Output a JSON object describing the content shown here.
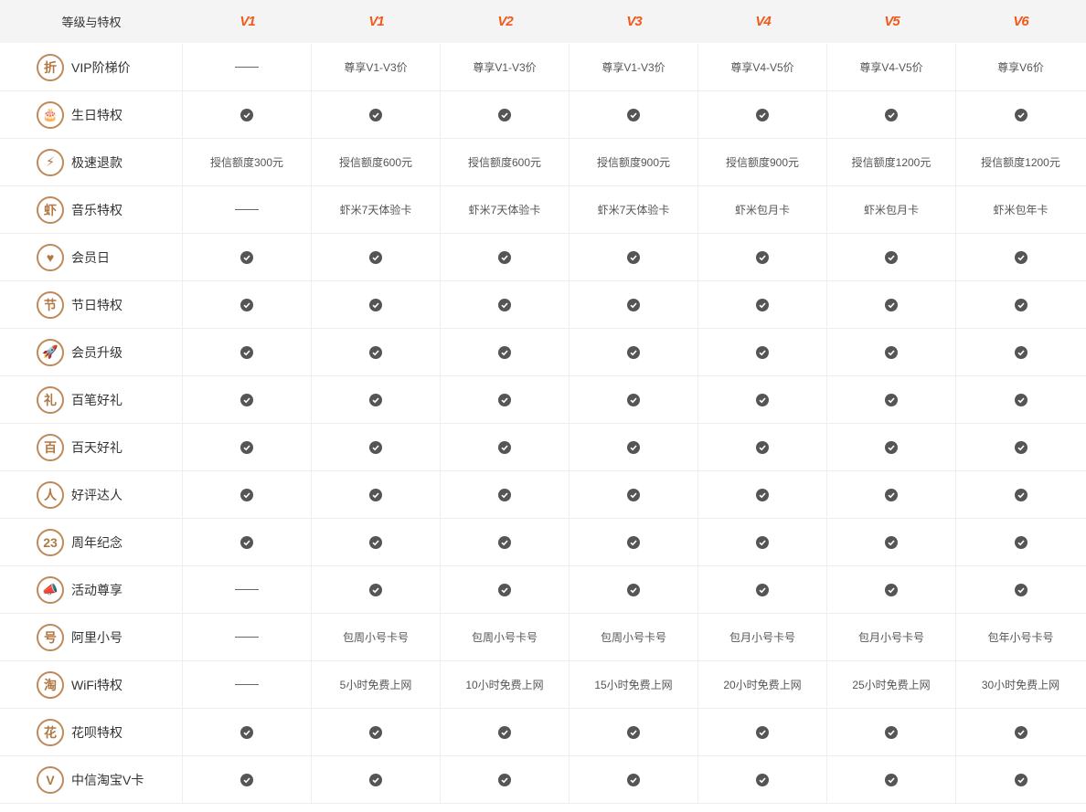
{
  "header": {
    "first_col": "等级与特权",
    "levels": [
      "V1",
      "V1",
      "V2",
      "V3",
      "V4",
      "V5",
      "V6"
    ]
  },
  "rows": [
    {
      "name": "VIP阶梯价",
      "icon": "discount-icon",
      "glyph": "折",
      "cells": [
        "-",
        "尊享V1-V3价",
        "尊享V1-V3价",
        "尊享V1-V3价",
        "尊享V4-V5价",
        "尊享V4-V5价",
        "尊享V6价"
      ]
    },
    {
      "name": "生日特权",
      "icon": "birthday-cake-icon",
      "glyph": "🎂",
      "cells": [
        "✓",
        "✓",
        "✓",
        "✓",
        "✓",
        "✓",
        "✓"
      ]
    },
    {
      "name": "极速退款",
      "icon": "lightning-icon",
      "glyph": "⚡",
      "cells": [
        "授信额度300元",
        "授信额度600元",
        "授信额度600元",
        "授信额度900元",
        "授信额度900元",
        "授信额度1200元",
        "授信额度1200元"
      ]
    },
    {
      "name": "音乐特权",
      "icon": "xiami-icon",
      "glyph": "虾",
      "cells": [
        "-",
        "虾米7天体验卡",
        "虾米7天体验卡",
        "虾米7天体验卡",
        "虾米包月卡",
        "虾米包月卡",
        "虾米包年卡"
      ]
    },
    {
      "name": "会员日",
      "icon": "calendar-heart-icon",
      "glyph": "♥",
      "cells": [
        "✓",
        "✓",
        "✓",
        "✓",
        "✓",
        "✓",
        "✓"
      ]
    },
    {
      "name": "节日特权",
      "icon": "holiday-icon",
      "glyph": "节",
      "cells": [
        "✓",
        "✓",
        "✓",
        "✓",
        "✓",
        "✓",
        "✓"
      ]
    },
    {
      "name": "会员升级",
      "icon": "rocket-icon",
      "glyph": "🚀",
      "cells": [
        "✓",
        "✓",
        "✓",
        "✓",
        "✓",
        "✓",
        "✓"
      ]
    },
    {
      "name": "百笔好礼",
      "icon": "gift-bag-icon",
      "glyph": "礼",
      "cells": [
        "✓",
        "✓",
        "✓",
        "✓",
        "✓",
        "✓",
        "✓"
      ]
    },
    {
      "name": "百天好礼",
      "icon": "gift-box-icon",
      "glyph": "百",
      "cells": [
        "✓",
        "✓",
        "✓",
        "✓",
        "✓",
        "✓",
        "✓"
      ]
    },
    {
      "name": "好评达人",
      "icon": "user-badge-icon",
      "glyph": "人",
      "cells": [
        "✓",
        "✓",
        "✓",
        "✓",
        "✓",
        "✓",
        "✓"
      ]
    },
    {
      "name": "周年纪念",
      "icon": "anniversary-calendar-icon",
      "glyph": "23",
      "cells": [
        "✓",
        "✓",
        "✓",
        "✓",
        "✓",
        "✓",
        "✓"
      ]
    },
    {
      "name": "活动尊享",
      "icon": "megaphone-icon",
      "glyph": "📣",
      "cells": [
        "-",
        "✓",
        "✓",
        "✓",
        "✓",
        "✓",
        "✓"
      ]
    },
    {
      "name": "阿里小号",
      "icon": "phone-icon",
      "glyph": "号",
      "cells": [
        "-",
        "包周小号卡号",
        "包周小号卡号",
        "包周小号卡号",
        "包月小号卡号",
        "包月小号卡号",
        "包年小号卡号"
      ]
    },
    {
      "name": "WiFi特权",
      "icon": "wifi-icon",
      "glyph": "淘",
      "cells": [
        "-",
        "5小时免费上网",
        "10小时免费上网",
        "15小时免费上网",
        "20小时免费上网",
        "25小时免费上网",
        "30小时免费上网"
      ]
    },
    {
      "name": "花呗特权",
      "icon": "huabei-icon",
      "glyph": "花",
      "cells": [
        "✓",
        "✓",
        "✓",
        "✓",
        "✓",
        "✓",
        "✓"
      ]
    },
    {
      "name": "中信淘宝V卡",
      "icon": "credit-card-icon",
      "glyph": "V",
      "cells": [
        "✓",
        "✓",
        "✓",
        "✓",
        "✓",
        "✓",
        "✓"
      ]
    }
  ]
}
